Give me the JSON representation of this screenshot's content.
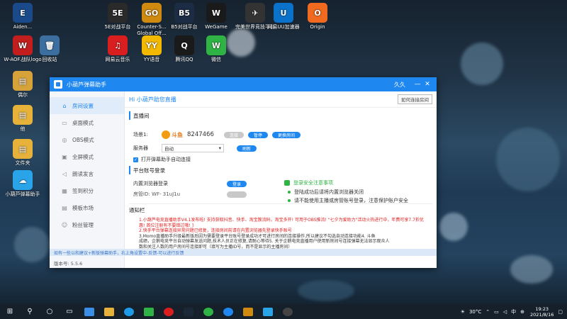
{
  "desktop": {
    "icons": [
      {
        "id": "aiden",
        "label": "Aiden...",
        "color": "#1a4a8a",
        "glyph": "E"
      },
      {
        "id": "5e",
        "label": "5E对战平台",
        "color": "#2a2a2a",
        "glyph": "5E"
      },
      {
        "id": "csgo",
        "label": "Counter-S... Global Off...",
        "color": "#d08a10",
        "glyph": "GO"
      },
      {
        "id": "b5",
        "label": "B5对战平台",
        "color": "#1b2c44",
        "glyph": "B5"
      },
      {
        "id": "wegame",
        "label": "WeGame",
        "color": "#1a1a1a",
        "glyph": "W"
      },
      {
        "id": "wanmei",
        "label": "完美世界竞技平台",
        "color": "#333",
        "glyph": "✈"
      },
      {
        "id": "uu",
        "label": "网易UU加速器",
        "color": "#0a72c9",
        "glyph": "U"
      },
      {
        "id": "origin",
        "label": "Origin",
        "color": "#f06a20",
        "glyph": "O"
      },
      {
        "id": "aoe",
        "label": "W-AOF.战队logo",
        "color": "#c21e1e",
        "glyph": "W"
      },
      {
        "id": "recycle",
        "label": "回收站",
        "color": "#3c6ea0",
        "glyph": "🗑"
      },
      {
        "id": "music",
        "label": "网易云音乐",
        "color": "#d81e1e",
        "glyph": "♫"
      },
      {
        "id": "yy",
        "label": "YY语音",
        "color": "#f3b800",
        "glyph": "YY"
      },
      {
        "id": "qq",
        "label": "腾讯QQ",
        "color": "#1a1a1a",
        "glyph": "Q"
      },
      {
        "id": "wechat",
        "label": "微信",
        "color": "#2fb344",
        "glyph": "W"
      },
      {
        "id": "beiwang",
        "label": "偶尔",
        "color": "#d6a23a",
        "glyph": "▤"
      },
      {
        "id": "folder1",
        "label": "他",
        "color": "#e6b23a",
        "glyph": "▤"
      },
      {
        "id": "folder2",
        "label": "文件夹",
        "color": "#e6b23a",
        "glyph": "▤"
      },
      {
        "id": "danmu",
        "label": "小葫芦弹幕助手",
        "color": "#2aa4e8",
        "glyph": "☁"
      }
    ]
  },
  "window": {
    "title": "小葫芦弹幕助手",
    "user": "久久",
    "controls": {
      "min": "—",
      "close": "✕"
    },
    "sidebar": [
      {
        "id": "room",
        "label": "房间设置",
        "icon": "home-icon",
        "glyph": "⌂",
        "active": true
      },
      {
        "id": "desktop",
        "label": "桌面模式",
        "icon": "monitor-icon",
        "glyph": "▭",
        "active": false
      },
      {
        "id": "obs",
        "label": "OBS模式",
        "icon": "obs-icon",
        "glyph": "◎",
        "active": false
      },
      {
        "id": "fullscreen",
        "label": "全屏模式",
        "icon": "fullscreen-icon",
        "glyph": "▣",
        "active": false
      },
      {
        "id": "voice",
        "label": "朗读发言",
        "icon": "speaker-icon",
        "glyph": "◁",
        "active": false
      },
      {
        "id": "checkin",
        "label": "签到积分",
        "icon": "calendar-icon",
        "glyph": "▦",
        "active": false
      },
      {
        "id": "template",
        "label": "模板市场",
        "icon": "store-icon",
        "glyph": "▤",
        "active": false
      },
      {
        "id": "fans",
        "label": "粉丝管理",
        "icon": "user-icon",
        "glyph": "☺",
        "active": false
      }
    ],
    "header": {
      "title": "Hi  小葫芦助您直播",
      "help": "如何连接房间"
    },
    "live": {
      "section": "直播间",
      "scene_label": "场景1:",
      "platform": "斗鱼",
      "room_id": "8247466",
      "connect": "连接",
      "pause": "暂停",
      "switch_room": "更换房间",
      "server_label": "服务器",
      "server_value": "自动",
      "refresh": "刷新",
      "auto_connect": "打开弹幕助手自动连接"
    },
    "account": {
      "section": "平台账号登录",
      "browser_label": "内置浏览器登录",
      "login": "登录",
      "room_label": "房管ID: WF- 31uJ1u",
      "safety_title": "登录安全注意事项",
      "safety_1": "登陆成功后请将内置浏览器关闭",
      "safety_2": "请不能使用主播或房管账号登录，注意保护账户安全"
    },
    "notice": {
      "section": "通知栏",
      "line1": "1.小葫芦电竞直播助手V4.1发布啦! 支持获取抖音、快手、淘宝簇流码，淘宝多开! 可用于OBS推流! \"七夕为爱助力\"活动火热进行中，年费可享7.7折优惠! 首位注册有不要错过哦! ]",
      "line2": "2.快手平台弹幕连接异常问题已修复，连接房间前请在内置浏览器先登录快手账号",
      "line3": "3.Momo直播助手升级最新版后因为需要登录平台账号登录成功才可进行房间的连接操作,所以建议不勾选自动连接功能4. 斗鱼",
      "line4": "成绩，企鹅电竞平台自动弹幕发送问题,技术人员正在修复,请耐心等待5. 关于企鹅电竞直播用户使用新房间号连接弹幕无法显示观众人",
      "line5": "数和关注人数的用户房间号连接即可（填写为主播ID号，而不是显示的主播房间）"
    },
    "tip": "如有一些以和建议+新版弹幕助手，右上角设置中-反馈-可以进行反馈",
    "version": "版本号: 5.5.6"
  },
  "taskbar": {
    "temp": "30°C",
    "lang": "中",
    "time": "19:23",
    "date": "2021/8/16"
  }
}
